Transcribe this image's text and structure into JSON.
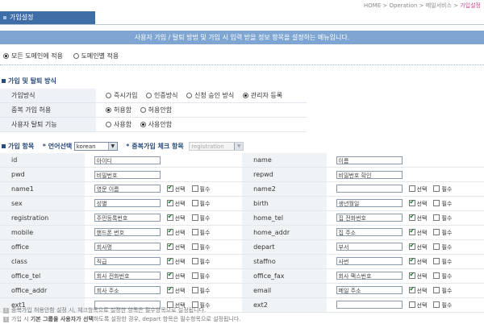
{
  "breadcrumb": {
    "home": "HOME",
    "sep": ">",
    "item1": "Operation",
    "item2": "메일서비스",
    "current": "가입설정"
  },
  "title": "가입설정",
  "description": "사용자 가입 / 탈퇴 방법 및 가입 시 입력 받을 정보 항목을 설정하는 메뉴입니다.",
  "scope": {
    "opt1": "모든 도메인에 적용",
    "opt2": "도메인별 적용"
  },
  "join_section": {
    "title": "가입 및 탈퇴 방식",
    "rows": [
      {
        "label": "가입방식",
        "options": [
          "즉시가입",
          "인증방식",
          "신청 승인 방식",
          "관리자 등록"
        ]
      },
      {
        "label": "중복 가입 허용",
        "options": [
          "허용함",
          "허용안함"
        ]
      },
      {
        "label": "사용자 탈퇴 기능",
        "options": [
          "사용함",
          "사용안함"
        ]
      }
    ]
  },
  "fields_section": {
    "title": "가입 항목",
    "lang_label": "* 언어선택",
    "lang_value": "korean",
    "dup_label": "* 중복가입 체크 항목",
    "dup_value": "registration",
    "select_label": "선택",
    "required_label": "필수"
  },
  "fields": [
    {
      "lk": "id",
      "lv": "아이디",
      "rk": "name",
      "rv": "이름"
    },
    {
      "lk": "pwd",
      "lv": "비밀번호",
      "rk": "repwd",
      "rv": "비밀번호 확인"
    },
    {
      "lk": "name1",
      "lv": "영문 이름",
      "rk": "name2",
      "rv": ""
    },
    {
      "lk": "sex",
      "lv": "성별",
      "rk": "birth",
      "rv": "생년월일"
    },
    {
      "lk": "registration",
      "lv": "주민등록번호",
      "rk": "home_tel",
      "rv": "집 전화번호"
    },
    {
      "lk": "mobile",
      "lv": "핸드폰 번호",
      "rk": "home_addr",
      "rv": "집 주소"
    },
    {
      "lk": "office",
      "lv": "회사명",
      "rk": "depart",
      "rv": "부서"
    },
    {
      "lk": "class",
      "lv": "직급",
      "rk": "staffno",
      "rv": "사번"
    },
    {
      "lk": "office_tel",
      "lv": "회사 전화번호",
      "rk": "office_fax",
      "rv": "회사 팩스번호"
    },
    {
      "lk": "office_addr",
      "lv": "회사 주소",
      "rk": "email",
      "rv": "메일 주소"
    },
    {
      "lk": "ext1",
      "lv": "",
      "rk": "ext2",
      "rv": ""
    }
  ],
  "notes": {
    "line1": "중복가입 허용안함 설정 시, 체크항목으로 설정한 항목은 필수항목으로 설정됩니다.",
    "line2_a": "가입 시 ",
    "line2_b": "기본 그룹을 사용자가 선택",
    "line2_c": "하도록 설정한 경우, depart 항목은 필수항목으로 설정됩니다."
  }
}
